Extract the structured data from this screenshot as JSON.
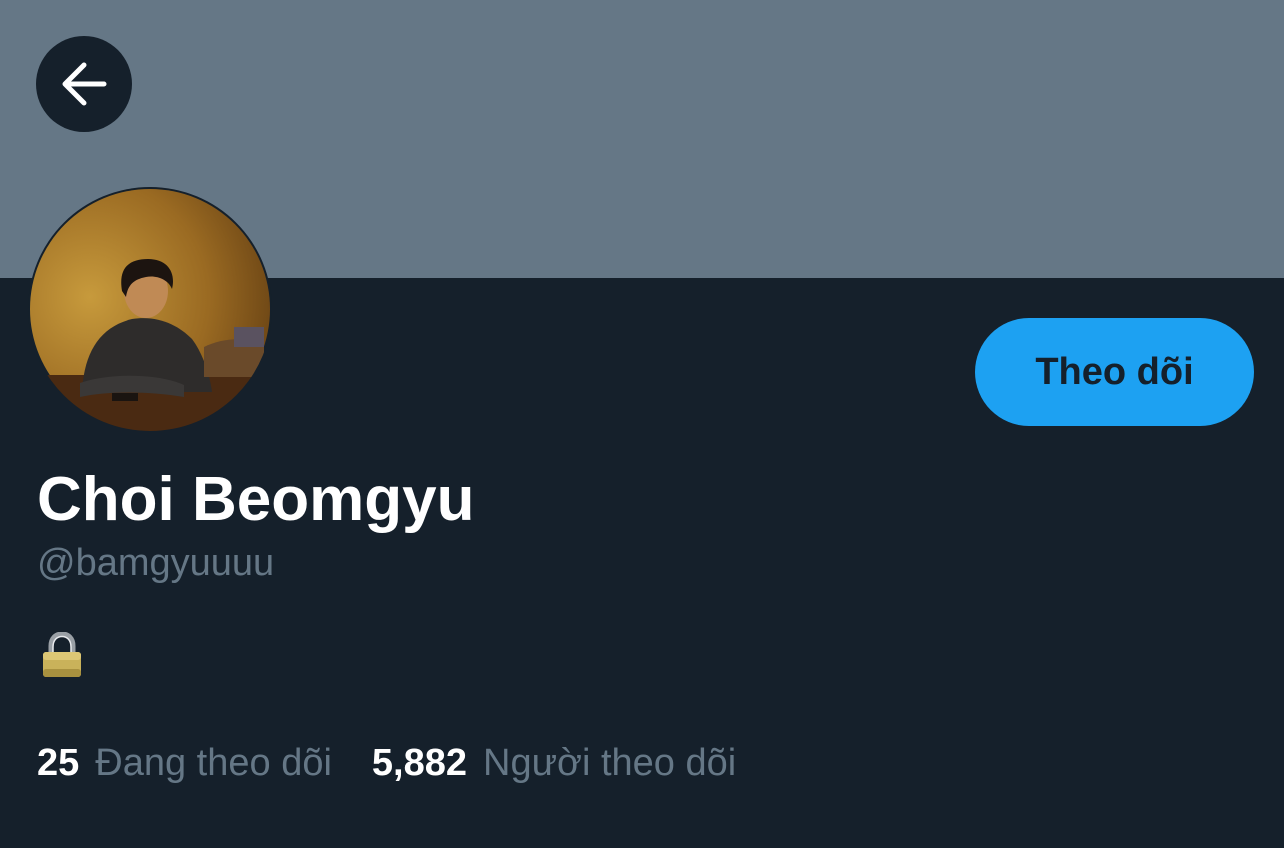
{
  "profile": {
    "display_name": "Choi Beomgyu",
    "handle": "@bamgyuuuu",
    "bio_icon": "lock-icon"
  },
  "actions": {
    "back_icon": "arrow-left-icon",
    "follow_label": "Theo dõi"
  },
  "stats": {
    "following_count": "25",
    "following_label": "Đang theo dõi",
    "followers_count": "5,882",
    "followers_label": "Người theo dõi"
  },
  "colors": {
    "background": "#15202b",
    "banner": "#657786",
    "accent": "#1da1f2",
    "muted_text": "#657786",
    "primary_text": "#ffffff"
  }
}
